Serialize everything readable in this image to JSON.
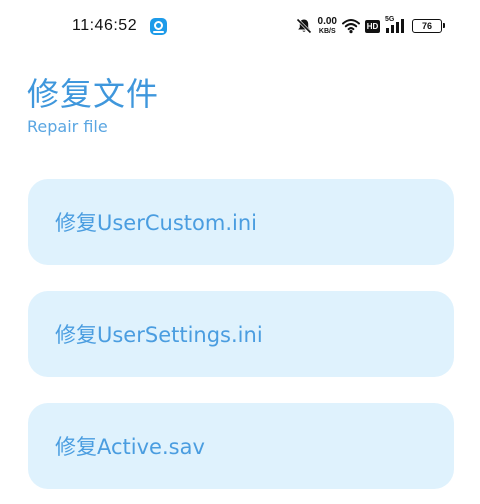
{
  "status_bar": {
    "time": "11:46:52",
    "net_speed_value": "0.00",
    "net_speed_unit": "KB/S",
    "hd_label": "HD",
    "signal_label": "5G",
    "battery_level": "76",
    "icons": [
      "app-badge-icon",
      "mute-bell-icon",
      "wifi-icon",
      "hd-icon",
      "signal-5g-icon",
      "battery-icon"
    ]
  },
  "header": {
    "title": "修复文件",
    "subtitle": "Repair file"
  },
  "actions": [
    {
      "label": "修复UserCustom.ini"
    },
    {
      "label": "修复UserSettings.ini"
    },
    {
      "label": "修复Active.sav"
    }
  ],
  "colors": {
    "accent": "#3f97dc",
    "card_background": "#dff2fd",
    "card_text": "#4a9de0"
  }
}
